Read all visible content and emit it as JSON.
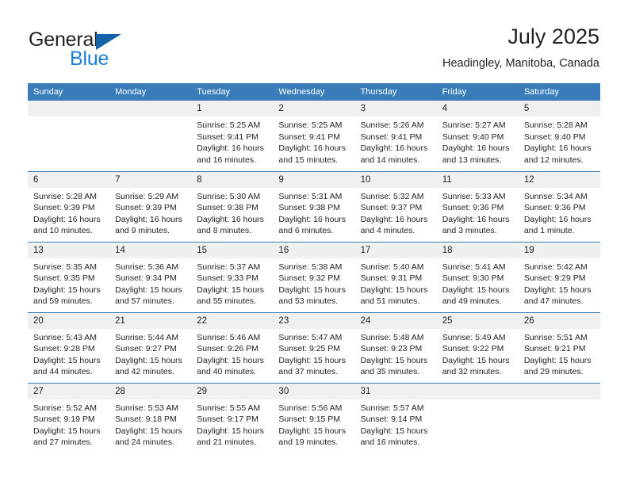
{
  "brand": {
    "name_part1": "General",
    "name_part2": "Blue",
    "triangle_icon": "triangle-icon",
    "color_dark": "#231f20",
    "color_blue": "#1c7fd4"
  },
  "header": {
    "title": "July 2025",
    "subtitle": "Headingley, Manitoba, Canada"
  },
  "calendar": {
    "header_bg": "#3a7cba",
    "daynum_bg": "#f0f0f0",
    "weekdays": [
      "Sunday",
      "Monday",
      "Tuesday",
      "Wednesday",
      "Thursday",
      "Friday",
      "Saturday"
    ],
    "weeks": [
      [
        {
          "day": "",
          "sunrise": "",
          "sunset": "",
          "daylight": "",
          "empty": true
        },
        {
          "day": "",
          "sunrise": "",
          "sunset": "",
          "daylight": "",
          "empty": true
        },
        {
          "day": "1",
          "sunrise": "Sunrise: 5:25 AM",
          "sunset": "Sunset: 9:41 PM",
          "daylight": "Daylight: 16 hours and 16 minutes."
        },
        {
          "day": "2",
          "sunrise": "Sunrise: 5:25 AM",
          "sunset": "Sunset: 9:41 PM",
          "daylight": "Daylight: 16 hours and 15 minutes."
        },
        {
          "day": "3",
          "sunrise": "Sunrise: 5:26 AM",
          "sunset": "Sunset: 9:41 PM",
          "daylight": "Daylight: 16 hours and 14 minutes."
        },
        {
          "day": "4",
          "sunrise": "Sunrise: 5:27 AM",
          "sunset": "Sunset: 9:40 PM",
          "daylight": "Daylight: 16 hours and 13 minutes."
        },
        {
          "day": "5",
          "sunrise": "Sunrise: 5:28 AM",
          "sunset": "Sunset: 9:40 PM",
          "daylight": "Daylight: 16 hours and 12 minutes."
        }
      ],
      [
        {
          "day": "6",
          "sunrise": "Sunrise: 5:28 AM",
          "sunset": "Sunset: 9:39 PM",
          "daylight": "Daylight: 16 hours and 10 minutes."
        },
        {
          "day": "7",
          "sunrise": "Sunrise: 5:29 AM",
          "sunset": "Sunset: 9:39 PM",
          "daylight": "Daylight: 16 hours and 9 minutes."
        },
        {
          "day": "8",
          "sunrise": "Sunrise: 5:30 AM",
          "sunset": "Sunset: 9:38 PM",
          "daylight": "Daylight: 16 hours and 8 minutes."
        },
        {
          "day": "9",
          "sunrise": "Sunrise: 5:31 AM",
          "sunset": "Sunset: 9:38 PM",
          "daylight": "Daylight: 16 hours and 6 minutes."
        },
        {
          "day": "10",
          "sunrise": "Sunrise: 5:32 AM",
          "sunset": "Sunset: 9:37 PM",
          "daylight": "Daylight: 16 hours and 4 minutes."
        },
        {
          "day": "11",
          "sunrise": "Sunrise: 5:33 AM",
          "sunset": "Sunset: 9:36 PM",
          "daylight": "Daylight: 16 hours and 3 minutes."
        },
        {
          "day": "12",
          "sunrise": "Sunrise: 5:34 AM",
          "sunset": "Sunset: 9:36 PM",
          "daylight": "Daylight: 16 hours and 1 minute."
        }
      ],
      [
        {
          "day": "13",
          "sunrise": "Sunrise: 5:35 AM",
          "sunset": "Sunset: 9:35 PM",
          "daylight": "Daylight: 15 hours and 59 minutes."
        },
        {
          "day": "14",
          "sunrise": "Sunrise: 5:36 AM",
          "sunset": "Sunset: 9:34 PM",
          "daylight": "Daylight: 15 hours and 57 minutes."
        },
        {
          "day": "15",
          "sunrise": "Sunrise: 5:37 AM",
          "sunset": "Sunset: 9:33 PM",
          "daylight": "Daylight: 15 hours and 55 minutes."
        },
        {
          "day": "16",
          "sunrise": "Sunrise: 5:38 AM",
          "sunset": "Sunset: 9:32 PM",
          "daylight": "Daylight: 15 hours and 53 minutes."
        },
        {
          "day": "17",
          "sunrise": "Sunrise: 5:40 AM",
          "sunset": "Sunset: 9:31 PM",
          "daylight": "Daylight: 15 hours and 51 minutes."
        },
        {
          "day": "18",
          "sunrise": "Sunrise: 5:41 AM",
          "sunset": "Sunset: 9:30 PM",
          "daylight": "Daylight: 15 hours and 49 minutes."
        },
        {
          "day": "19",
          "sunrise": "Sunrise: 5:42 AM",
          "sunset": "Sunset: 9:29 PM",
          "daylight": "Daylight: 15 hours and 47 minutes."
        }
      ],
      [
        {
          "day": "20",
          "sunrise": "Sunrise: 5:43 AM",
          "sunset": "Sunset: 9:28 PM",
          "daylight": "Daylight: 15 hours and 44 minutes."
        },
        {
          "day": "21",
          "sunrise": "Sunrise: 5:44 AM",
          "sunset": "Sunset: 9:27 PM",
          "daylight": "Daylight: 15 hours and 42 minutes."
        },
        {
          "day": "22",
          "sunrise": "Sunrise: 5:46 AM",
          "sunset": "Sunset: 9:26 PM",
          "daylight": "Daylight: 15 hours and 40 minutes."
        },
        {
          "day": "23",
          "sunrise": "Sunrise: 5:47 AM",
          "sunset": "Sunset: 9:25 PM",
          "daylight": "Daylight: 15 hours and 37 minutes."
        },
        {
          "day": "24",
          "sunrise": "Sunrise: 5:48 AM",
          "sunset": "Sunset: 9:23 PM",
          "daylight": "Daylight: 15 hours and 35 minutes."
        },
        {
          "day": "25",
          "sunrise": "Sunrise: 5:49 AM",
          "sunset": "Sunset: 9:22 PM",
          "daylight": "Daylight: 15 hours and 32 minutes."
        },
        {
          "day": "26",
          "sunrise": "Sunrise: 5:51 AM",
          "sunset": "Sunset: 9:21 PM",
          "daylight": "Daylight: 15 hours and 29 minutes."
        }
      ],
      [
        {
          "day": "27",
          "sunrise": "Sunrise: 5:52 AM",
          "sunset": "Sunset: 9:19 PM",
          "daylight": "Daylight: 15 hours and 27 minutes."
        },
        {
          "day": "28",
          "sunrise": "Sunrise: 5:53 AM",
          "sunset": "Sunset: 9:18 PM",
          "daylight": "Daylight: 15 hours and 24 minutes."
        },
        {
          "day": "29",
          "sunrise": "Sunrise: 5:55 AM",
          "sunset": "Sunset: 9:17 PM",
          "daylight": "Daylight: 15 hours and 21 minutes."
        },
        {
          "day": "30",
          "sunrise": "Sunrise: 5:56 AM",
          "sunset": "Sunset: 9:15 PM",
          "daylight": "Daylight: 15 hours and 19 minutes."
        },
        {
          "day": "31",
          "sunrise": "Sunrise: 5:57 AM",
          "sunset": "Sunset: 9:14 PM",
          "daylight": "Daylight: 15 hours and 16 minutes."
        },
        {
          "day": "",
          "sunrise": "",
          "sunset": "",
          "daylight": "",
          "empty": true
        },
        {
          "day": "",
          "sunrise": "",
          "sunset": "",
          "daylight": "",
          "empty": true
        }
      ]
    ]
  }
}
